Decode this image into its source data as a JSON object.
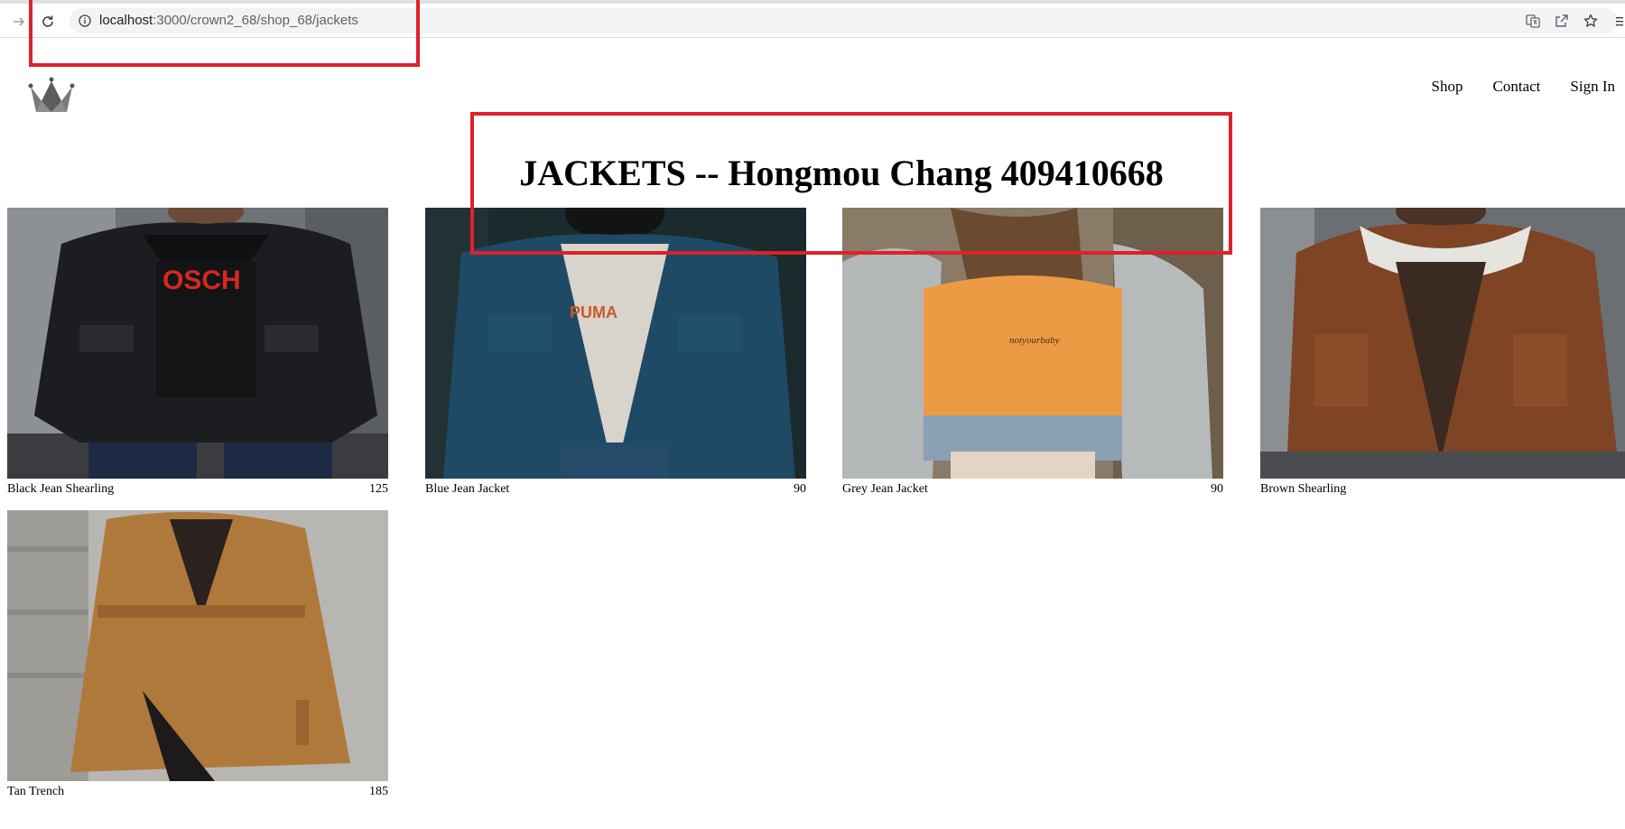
{
  "browser": {
    "url_host": "localhost",
    "url_path": ":3000/crown2_68/shop_68/jackets",
    "icons": [
      "forward-icon",
      "reload-icon",
      "info-icon",
      "translate-icon",
      "share-icon",
      "bookmark-star-icon"
    ]
  },
  "header": {
    "logo": "crown-logo",
    "nav": [
      {
        "label": "Shop"
      },
      {
        "label": "Contact"
      },
      {
        "label": "Sign In"
      }
    ]
  },
  "page": {
    "title": "JACKETS -- Hongmou Chang 409410668"
  },
  "products": [
    {
      "name": "Black Jean Shearling",
      "price": "125"
    },
    {
      "name": "Blue Jean Jacket",
      "price": "90"
    },
    {
      "name": "Grey Jean Jacket",
      "price": "90"
    },
    {
      "name": "Brown Shearling",
      "price": ""
    },
    {
      "name": "Tan Trench",
      "price": "185"
    }
  ],
  "colors": {
    "annotation": "#e0202a",
    "omnibox": "#f1f3f4"
  }
}
